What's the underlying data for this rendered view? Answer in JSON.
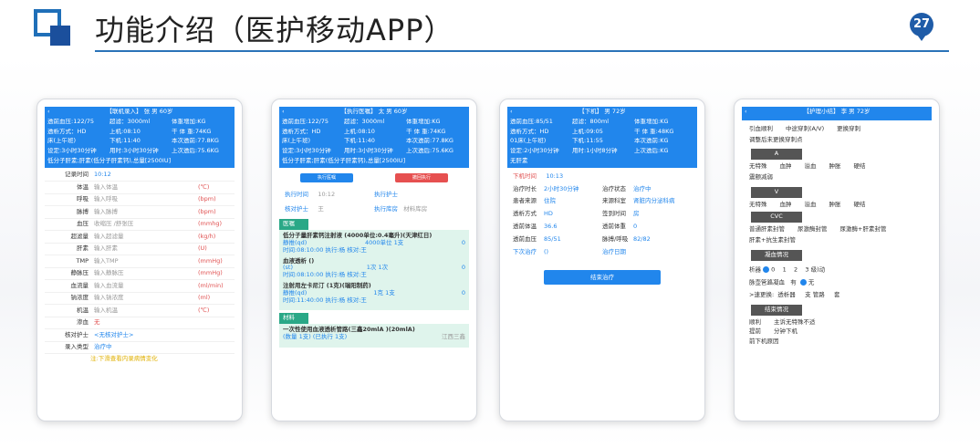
{
  "page": {
    "title": "功能介绍（医护移动APP）",
    "page_number": "27",
    "accent_color": "#2a73b8"
  },
  "t1": {
    "header_title": "【联机录入】 张 男  60岁",
    "stats": [
      "透前血压:122/75",
      "超滤：3000ml",
      "体重增加:KG",
      "透析方式：HD",
      "上机:08:10",
      "干 体 重:74KG",
      "床(上午班)",
      "下机:11:40",
      "本次透前:77.8KG",
      "设定:3小时30分钟",
      "用时:3小时30分钟",
      "上次透后:75.6KG"
    ],
    "anticoag": "低分子肝素;肝素(低分子肝素钙),总量[2500IU]",
    "rows": [
      {
        "label": "记录时间",
        "value": "10:12",
        "unit": ""
      },
      {
        "label": "体温",
        "value": "输入体温",
        "unit": "(℃)"
      },
      {
        "label": "呼吸",
        "value": "输入呼吸",
        "unit": "(bpm)"
      },
      {
        "label": "脉搏",
        "value": "输入脉搏",
        "unit": "(bpm)"
      },
      {
        "label": "血压",
        "value": "收缩压 /舒张压",
        "unit": "(mmhg)"
      },
      {
        "label": "超滤量",
        "value": "输入超滤量",
        "unit": "(kg/h)"
      },
      {
        "label": "肝素",
        "value": "输入肝素",
        "unit": "(U)"
      },
      {
        "label": "TMP",
        "value": "输入TMP",
        "unit": "(mmHg)"
      },
      {
        "label": "静脉压",
        "value": "输入静脉压",
        "unit": "(mmHg)"
      },
      {
        "label": "血流量",
        "value": "输入血流量",
        "unit": "(ml/min)"
      },
      {
        "label": "钠浓度",
        "value": "输入钠浓度",
        "unit": "(ml)"
      },
      {
        "label": "机温",
        "value": "输入机温",
        "unit": "(℃)"
      },
      {
        "label": "渗血",
        "value": "",
        "unit": "无"
      },
      {
        "label": "核对护士",
        "value": "<无核对护士>",
        "unit": ""
      },
      {
        "label": "录入类型",
        "value": "治疗中",
        "unit": ""
      }
    ],
    "hint": "注:下滑查看内录病情变化"
  },
  "t2": {
    "header_title": "【执行医嘱】 太  男  60岁",
    "stats": [
      "透前血压:122/75",
      "超滤：3000ml",
      "体重增加:KG",
      "透析方式：HD",
      "上机:08:10",
      "干 体 重:74KG",
      "床(上午班)",
      "下机:11:40",
      "本次透前:77.8KG",
      "设定:3小时30分钟",
      "用时:3小时30分钟",
      "上次透后:75.6KG"
    ],
    "anticoag": "低分子肝素;肝素(低分子肝素钙),总量[2500IU]",
    "btn_exec": "执行医嘱",
    "btn_undo": "撤回执行",
    "exec_time_label": "执行时间",
    "exec_time": "10:12",
    "exec_nurse_label": "执行护士",
    "check_nurse_label": "核对护士",
    "check_nurse": "王",
    "exec_store_label": "执行库房",
    "exec_store": "材料库房",
    "section_orders": "医嘱",
    "orders": [
      {
        "name": "低分子量肝素钙注射液 (4000单位:0.4毫升)(天津红日)",
        "sub1": "静推(qd)",
        "sub2": "4000单位 1支",
        "sub3": "0",
        "time": "时间:08:10:00  执行:杨  核对:王"
      },
      {
        "name": "血液透析 ()",
        "sub1": "(st)",
        "sub2": "1次 1次",
        "sub3": "0",
        "time": "时间:08:10:00  执行:杨  核对:王"
      },
      {
        "name": "注射用左卡尼汀 (1克)(瑞阳制药)",
        "sub1": "静推(qd)",
        "sub2": "1克 1支",
        "sub3": "0",
        "time": "时间:11:40:00  执行:杨  核对:王"
      }
    ],
    "section_materials": "材料",
    "material": "一次性使用血液透析管路(三鑫20mlA )(20mlA)",
    "material_sub": "(数量  1支) (已执行 1支)",
    "material_vendor": "江西三鑫"
  },
  "t3": {
    "header_title": "【下机】  男  72岁",
    "stats": [
      "透前血压:85/51",
      "超滤：800ml",
      "体重增加:KG",
      "透析方式：HD",
      "上机:09:05",
      "干 体 重:48KG",
      "01床(上午班)",
      "下机:11:55",
      "本次透前:KG",
      "设定:2小时30分钟",
      "用时:1小时8分钟",
      "上次透后:KG"
    ],
    "anticoag": "无肝素",
    "offtime_label": "下机时间",
    "offtime": "10:13",
    "fields": [
      {
        "k": "治疗时长",
        "v": "2小时30分钟"
      },
      {
        "k": "治疗状态",
        "v": "治疗中"
      },
      {
        "k": "患者来源",
        "v": "住院"
      },
      {
        "k": "来源科室",
        "v": "肾脏内分泌科病"
      },
      {
        "k": "透析方式",
        "v": "HD"
      },
      {
        "k": "签到时间",
        "v": "房"
      },
      {
        "k": "透前体温",
        "v": "36.6"
      },
      {
        "k": "透前体重",
        "v": "0"
      },
      {
        "k": "透前血压",
        "v": "85/51"
      },
      {
        "k": "脉搏/呼吸",
        "v": "82/82"
      },
      {
        "k": "下次治疗",
        "v": "()"
      },
      {
        "k": "治疗日期",
        "v": ""
      }
    ],
    "end_button": "结束治疗"
  },
  "t4": {
    "header_title": "【护理小结】 李  男  72岁",
    "row1": [
      "引血顺利",
      "中途穿刺(A/V)",
      "更换穿刺"
    ],
    "row2": "调整后未更换穿刺点",
    "sec_a": "A",
    "a_opts": [
      "无特殊",
      "血肿",
      "溢血",
      "肿胀",
      "硬结"
    ],
    "a_extra": "震颤减弱",
    "sec_v": "V",
    "v_opts": [
      "无特殊",
      "血肿",
      "溢血",
      "肿胀",
      "硬结"
    ],
    "sec_cvc": "CVC",
    "cvc_opts": [
      "普通肝素封管",
      "尿激酶封管",
      "尿激酶+肝素封管"
    ],
    "cvc_extra": "肝素+抗生素封管",
    "sec_clot": "凝血情况",
    "clot_label": "析器",
    "clot_opts": [
      "0",
      "1",
      "2",
      "3",
      "级)动"
    ],
    "line_label": "脉壶管路凝血",
    "line_opts": [
      "有",
      "无"
    ],
    "change_label": ">速更换:",
    "change_opts": [
      "透析器",
      "支 管路",
      "套"
    ],
    "sec_end": "结束情况",
    "end_opts": [
      "顺利",
      "主诉无特殊不适"
    ],
    "end_opts2": [
      "提前",
      "分钟下机"
    ],
    "end_reason": "前下机原因"
  }
}
